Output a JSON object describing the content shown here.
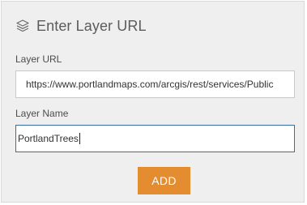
{
  "header": {
    "icon": "layers-icon",
    "title": "Enter Layer URL"
  },
  "layer_url": {
    "label": "Layer URL",
    "value": "https://www.portlandmaps.com/arcgis/rest/services/Public"
  },
  "layer_name": {
    "label": "Layer Name",
    "value": "PortlandTrees"
  },
  "add_button": {
    "label": "ADD",
    "color": "#e48d30"
  }
}
